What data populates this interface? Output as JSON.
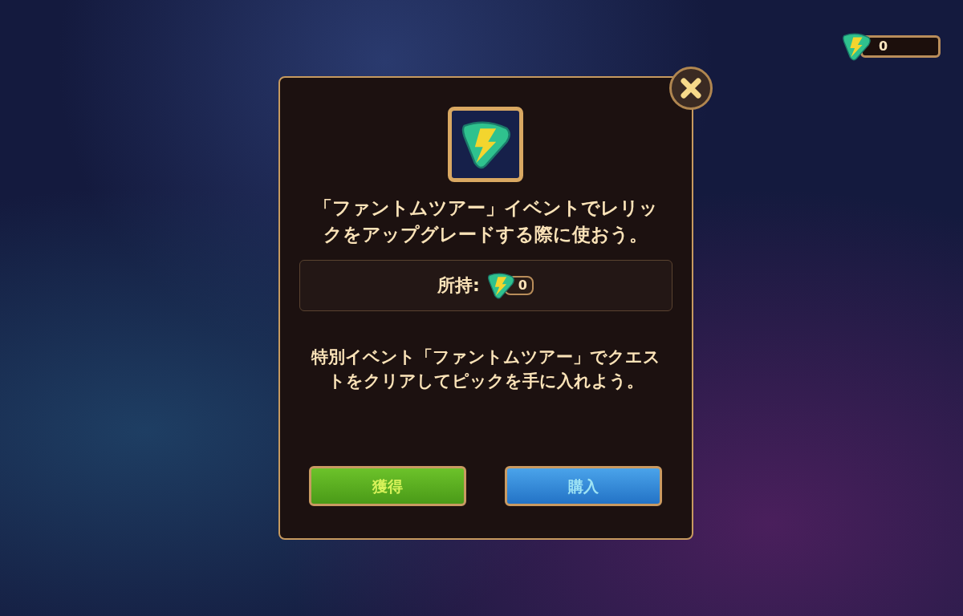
{
  "currency": {
    "amount": "0"
  },
  "dialog": {
    "description": "「ファントムツアー」イベントでレリックをアップグレードする際に使おう。",
    "holdings": {
      "label": "所持:",
      "amount": "0"
    },
    "instruction": "特別イベント「ファントムツアー」でクエストをクリアしてピックを手に入れよう。",
    "buttons": [
      {
        "label": "獲得",
        "kind": "earn"
      },
      {
        "label": "購入",
        "kind": "buy"
      }
    ]
  }
}
